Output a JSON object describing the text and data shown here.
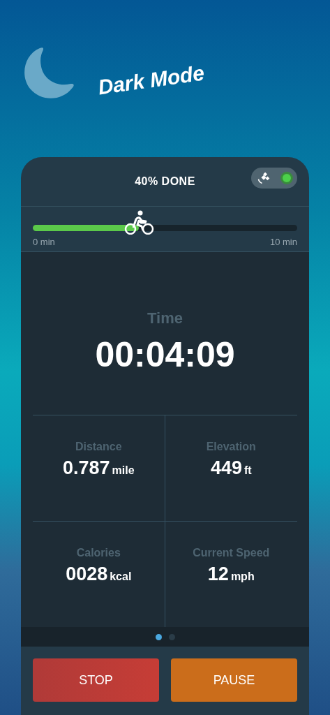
{
  "banner": {
    "title": "Dark Mode"
  },
  "header": {
    "title": "40% DONE",
    "gps": {
      "on": true
    }
  },
  "progress": {
    "level": 0.4,
    "start_label": "0 min",
    "end_label": "10 min"
  },
  "time": {
    "label": "Time",
    "value": "00:04:09"
  },
  "stats": [
    {
      "label": "Distance",
      "value": "0.787",
      "unit": "mile"
    },
    {
      "label": "Elevation",
      "value": "449",
      "unit": "ft"
    },
    {
      "label": "Calories",
      "value": "0028",
      "unit": "kcal"
    },
    {
      "label": "Current Speed",
      "value": "12",
      "unit": "mph"
    }
  ],
  "pages": [
    {
      "selected": true
    },
    {
      "selected": false
    }
  ],
  "buttons": [
    {
      "label": "STOP",
      "kind": "stop"
    },
    {
      "label": "PAUSE",
      "kind": "pause"
    }
  ]
}
